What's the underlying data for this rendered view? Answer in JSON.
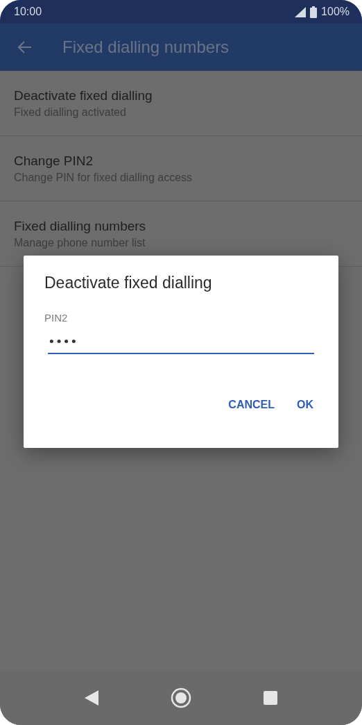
{
  "status_bar": {
    "time": "10:00",
    "battery": "100%"
  },
  "app_bar": {
    "title": "Fixed dialling numbers"
  },
  "settings": [
    {
      "title": "Deactivate fixed dialling",
      "subtitle": "Fixed dialling activated"
    },
    {
      "title": "Change PIN2",
      "subtitle": "Change PIN for fixed dialling access"
    },
    {
      "title": "Fixed dialling numbers",
      "subtitle": "Manage phone number list"
    }
  ],
  "dialog": {
    "title": "Deactivate fixed dialling",
    "field_label": "PIN2",
    "field_value": "••••",
    "buttons": [
      "CANCEL",
      "OK"
    ]
  }
}
